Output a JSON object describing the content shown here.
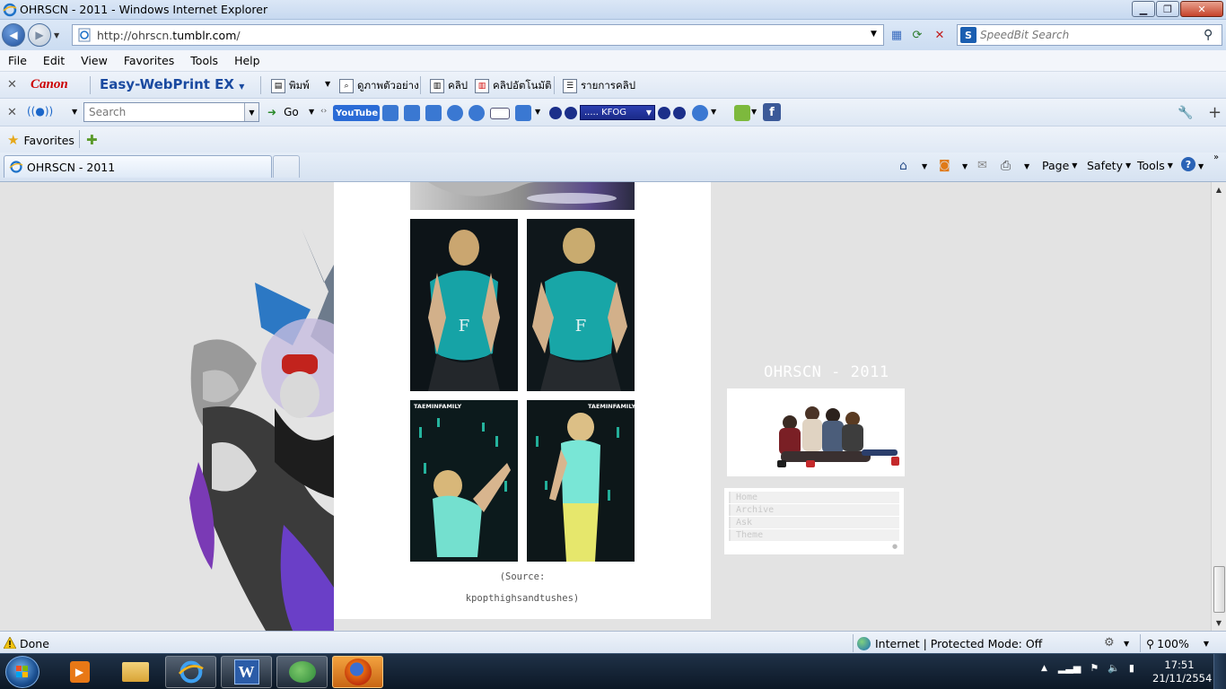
{
  "window": {
    "title": "OHRSCN - 2011 - Windows Internet Explorer"
  },
  "address": {
    "url_prefix": "http://ohrscn.",
    "url_domain": "tumblr.com",
    "url_suffix": "/"
  },
  "search_provider": {
    "placeholder": "SpeedBit Search"
  },
  "menu": [
    "File",
    "Edit",
    "View",
    "Favorites",
    "Tools",
    "Help"
  ],
  "canon_toolbar": {
    "brand": "Canon",
    "product": "Easy-WebPrint EX",
    "print": "พิมพ์",
    "preview": "ดูภาพตัวอย่าง",
    "clip": "คลิป",
    "auto_clip": "คลิปอัตโนมัติ",
    "clip_list": "รายการคลิป"
  },
  "second_toolbar": {
    "search_placeholder": "Search",
    "go_label": "Go",
    "youtube_label": "YouTube",
    "radio_station": "..... KFOG"
  },
  "favorites_bar": {
    "favorites_label": "Favorites"
  },
  "tabs": [
    {
      "label": "OHRSCN - 2011"
    }
  ],
  "command_bar": {
    "page": "Page",
    "safety": "Safety",
    "tools": "Tools"
  },
  "blog": {
    "title": "OHRSCN - 2011",
    "source_line1": "(Source:",
    "source_line2": "kpopthighsandtushes)",
    "photo_badge_left": "TAEMINFAMILY",
    "photo_badge_right": "TAEMINFAMILY",
    "nav": [
      "Home",
      "Archive",
      "Ask",
      "Theme"
    ]
  },
  "status": {
    "text": "Done",
    "zone": "Internet | Protected Mode: Off",
    "zoom": "100%"
  },
  "taskbar": {
    "time": "17:51",
    "date": "21/11/2554"
  },
  "colors": {
    "chrome_blue": "#bcd3ee",
    "page_bg": "#e3e3e3",
    "canon_red": "#cc0000",
    "taskbar_dark": "#0c1826"
  }
}
